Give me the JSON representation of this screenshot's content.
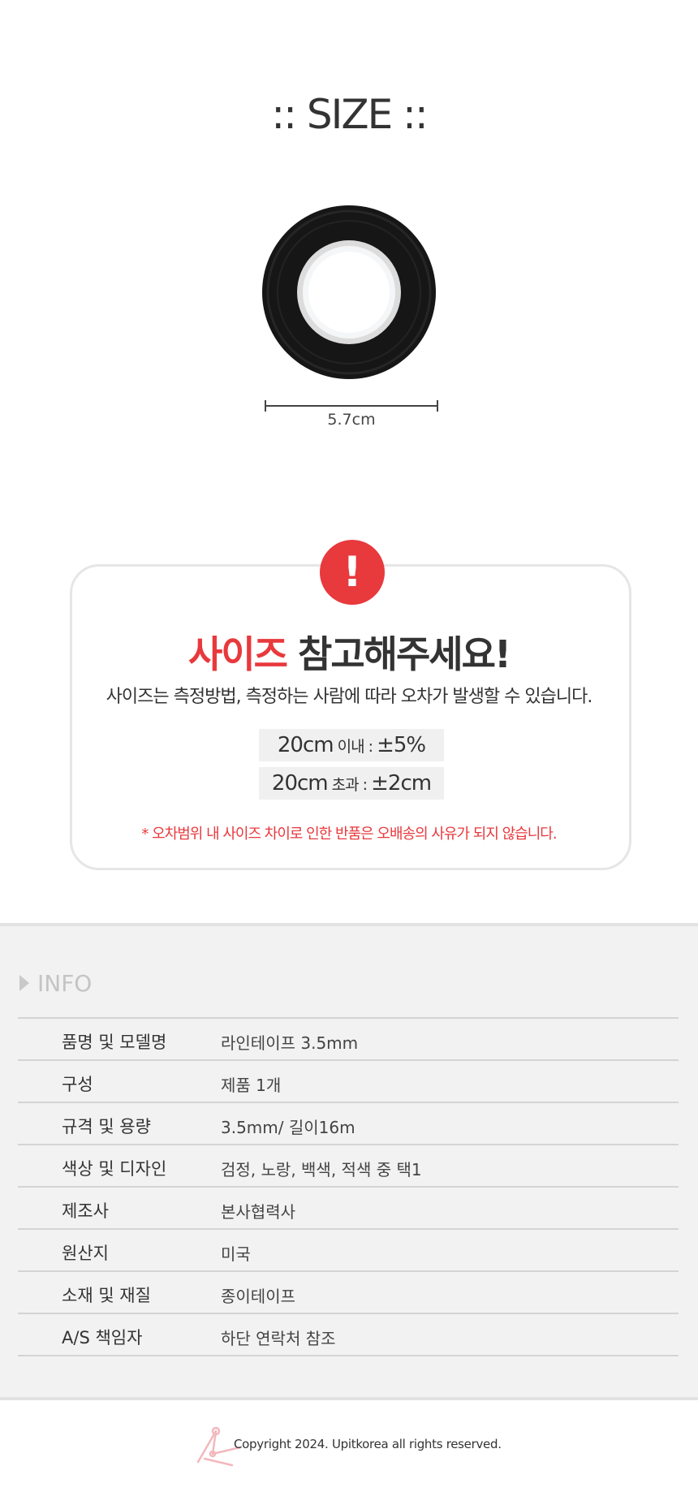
{
  "size_section": {
    "title": ":: SIZE ::",
    "measurement": "5.7cm"
  },
  "notice": {
    "title_red": "사이즈",
    "title_rest": " 참고해주세요!",
    "badge": "!",
    "description": "사이즈는 측정방법, 측정하는 사람에 따라 오차가 발생할 수 있습니다.",
    "tolerance": [
      {
        "size": "20cm",
        "qualifier": " 이내 : ",
        "value": "±5%"
      },
      {
        "size": "20cm",
        "qualifier": " 초과 : ",
        "value": "±2cm"
      }
    ],
    "warning": "* 오차범위 내 사이즈 차이로 인한 반품은 오배송의 사유가 되지 않습니다."
  },
  "info": {
    "heading": "INFO",
    "rows": [
      {
        "label": "품명 및 모델명",
        "value": "라인테이프 3.5mm"
      },
      {
        "label": "구성",
        "value": "제품 1개"
      },
      {
        "label": "규격 및 용량",
        "value": "3.5mm/ 길이16m"
      },
      {
        "label": "색상 및 디자인",
        "value": "검정, 노랑, 백색, 적색 중 택1"
      },
      {
        "label": "제조사",
        "value": "본사협력사"
      },
      {
        "label": "원산지",
        "value": "미국"
      },
      {
        "label": "소재 및 재질",
        "value": "종이테이프"
      },
      {
        "label": "A/S 책임자",
        "value": "하단 연락처 참조"
      }
    ]
  },
  "footer": {
    "copyright": "Copyright 2024. Upitkorea all rights reserved."
  },
  "colors": {
    "accent_red": "#e8393d",
    "info_background": "#f2f2f2",
    "tape_black": "#1a1a1a"
  }
}
